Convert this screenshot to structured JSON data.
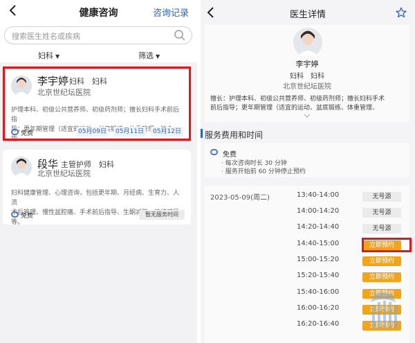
{
  "left": {
    "back_icon": "chevron-left-icon",
    "title": "健康咨询",
    "history_link": "咨询记录",
    "search_placeholder": "搜索医生姓名或疾病",
    "filters": [
      "妇科",
      "筛选"
    ],
    "doctors": [
      {
        "name": "李宇婷",
        "title": "妇科　妇科",
        "hospital": "北京世纪坛医院",
        "desc_line1": "护理本科、初级公共营养师、初级药剂师；擅长妇科手术前后指",
        "desc_line2": "导；更年期管理（适宜的运动、盆底锻练、体重管理、饮食指…",
        "fee": "免费",
        "dates": [
          "05月09日",
          "05月11日",
          "05月12日"
        ]
      },
      {
        "name": "段华",
        "title": "主管护师　妇科",
        "hospital": "北京世纪坛医院",
        "desc_line1": "妇科健康管理、心理咨询，包括更年期、月经病、生育力、人流",
        "desc_line2": "术后管理、慢性盆腔痛、手术前后指导、生酮减脂、情绪疏导等。",
        "fee": "免费",
        "status": "暂无服务时间"
      }
    ]
  },
  "right": {
    "title": "医生详情",
    "favorite_icon": "star-icon",
    "doctor": {
      "name": "李宇婷",
      "title": "妇科　妇科",
      "hospital": "北京世纪坛医院",
      "desc_line1": "擅长：护理本科、初级公共营养师、初级药剂师；擅长妇科手术",
      "desc_line2": "前后指导；更年期管理（适宜的运动、盆底锻练、体重管理、"
    },
    "section_title": "服务费用和时间",
    "fee": {
      "label": "免费",
      "notes": [
        "· 每次咨询时长 30 分钟",
        "· 服务开始前 60 分钟停止预约"
      ]
    },
    "slots": {
      "date": "2023-05-09(周二)",
      "times": [
        "13:40-14:00",
        "14:00-14:20",
        "14:20-14:40",
        "14:40-15:00",
        "15:00-15:20",
        "15:20-15:40",
        "15:40-16:00",
        "16:00-16:20",
        "16:20-16:40"
      ],
      "buttons": [
        "无号源",
        "无号源",
        "无号源",
        "立即预约",
        "立即预约",
        "立即预约",
        "立即预约",
        "立即预约",
        "立即预约"
      ]
    },
    "colors": {
      "accent": "#2a63c8",
      "book": "#f1a51d",
      "highlight": "#e8141b"
    }
  }
}
